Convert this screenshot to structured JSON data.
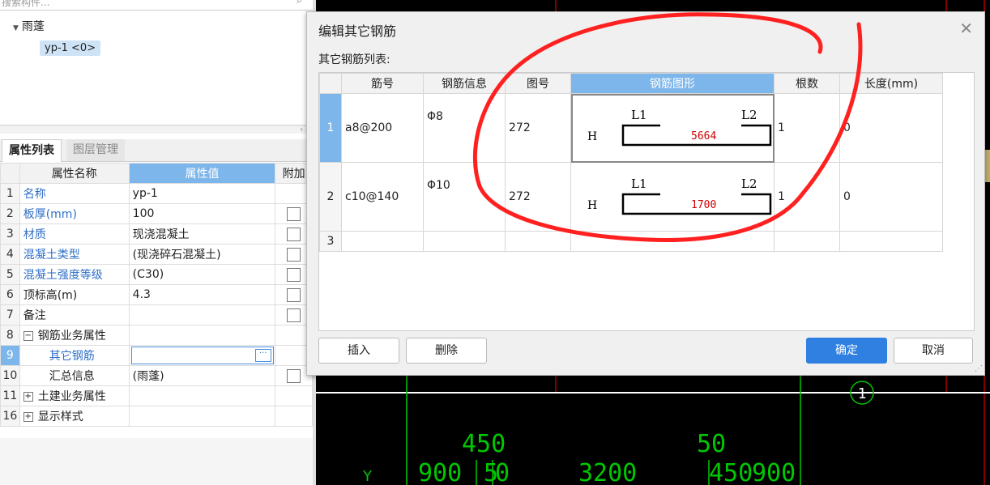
{
  "search": {
    "placeholder": "搜索构件..."
  },
  "tree": {
    "root": "雨蓬",
    "node": "yp-1 <0>"
  },
  "panel_tabs": [
    "属性列表",
    "图层管理"
  ],
  "props": {
    "headers": [
      "属性名称",
      "属性值",
      "附加"
    ],
    "rows": [
      {
        "num": "1",
        "name": "名称",
        "value": "yp-1"
      },
      {
        "num": "2",
        "name": "板厚(mm)",
        "value": "100"
      },
      {
        "num": "3",
        "name": "材质",
        "value": "现浇混凝土"
      },
      {
        "num": "4",
        "name": "混凝土类型",
        "value": "(现浇碎石混凝土)"
      },
      {
        "num": "5",
        "name": "混凝土强度等级",
        "value": "(C30)"
      },
      {
        "num": "6",
        "name": "顶标高(m)",
        "value": "4.3"
      },
      {
        "num": "7",
        "name": "备注",
        "value": ""
      },
      {
        "num": "8",
        "name": "钢筋业务属性",
        "value": ""
      },
      {
        "num": "9",
        "name": "其它钢筋",
        "value": ""
      },
      {
        "num": "10",
        "name": "汇总信息",
        "value": "(雨蓬)"
      },
      {
        "num": "11",
        "name": "土建业务属性",
        "value": ""
      },
      {
        "num": "16",
        "name": "显示样式",
        "value": ""
      }
    ]
  },
  "dialog": {
    "title": "编辑其它钢筋",
    "list_label": "其它钢筋列表:",
    "headers": [
      "筋号",
      "钢筋信息",
      "图号",
      "钢筋图形",
      "根数",
      "长度(mm)"
    ],
    "rows": [
      {
        "num": "1",
        "code": "a8@200",
        "info": "Φ8",
        "fig": "272",
        "shape_h": "H",
        "shape_l1": "L1",
        "shape_l2": "L2",
        "shape_val": "5664",
        "count": "1",
        "length": "0"
      },
      {
        "num": "2",
        "code": "c10@140",
        "info": "Φ10",
        "fig": "272",
        "shape_h": "H",
        "shape_l1": "L1",
        "shape_l2": "L2",
        "shape_val": "1700",
        "count": "1",
        "length": "0"
      },
      {
        "num": "3"
      }
    ],
    "buttons": {
      "insert": "插入",
      "delete": "删除",
      "ok": "确定",
      "cancel": "取消"
    }
  },
  "cad": {
    "labels": {
      "n450a": "450",
      "n50": "50",
      "n900a": "900",
      "n5": "5",
      "n0": "0",
      "n3200": "3200",
      "n450b": "450",
      "n900b": "900",
      "y": "Y",
      "circle": "1"
    }
  },
  "colors": {
    "accent": "#7db6ea",
    "primary_button": "#2f80e0",
    "cad_line": "#00c800",
    "cad_red": "#b00000",
    "annotation": "#ff2020",
    "link_text": "#2f6fc7"
  }
}
